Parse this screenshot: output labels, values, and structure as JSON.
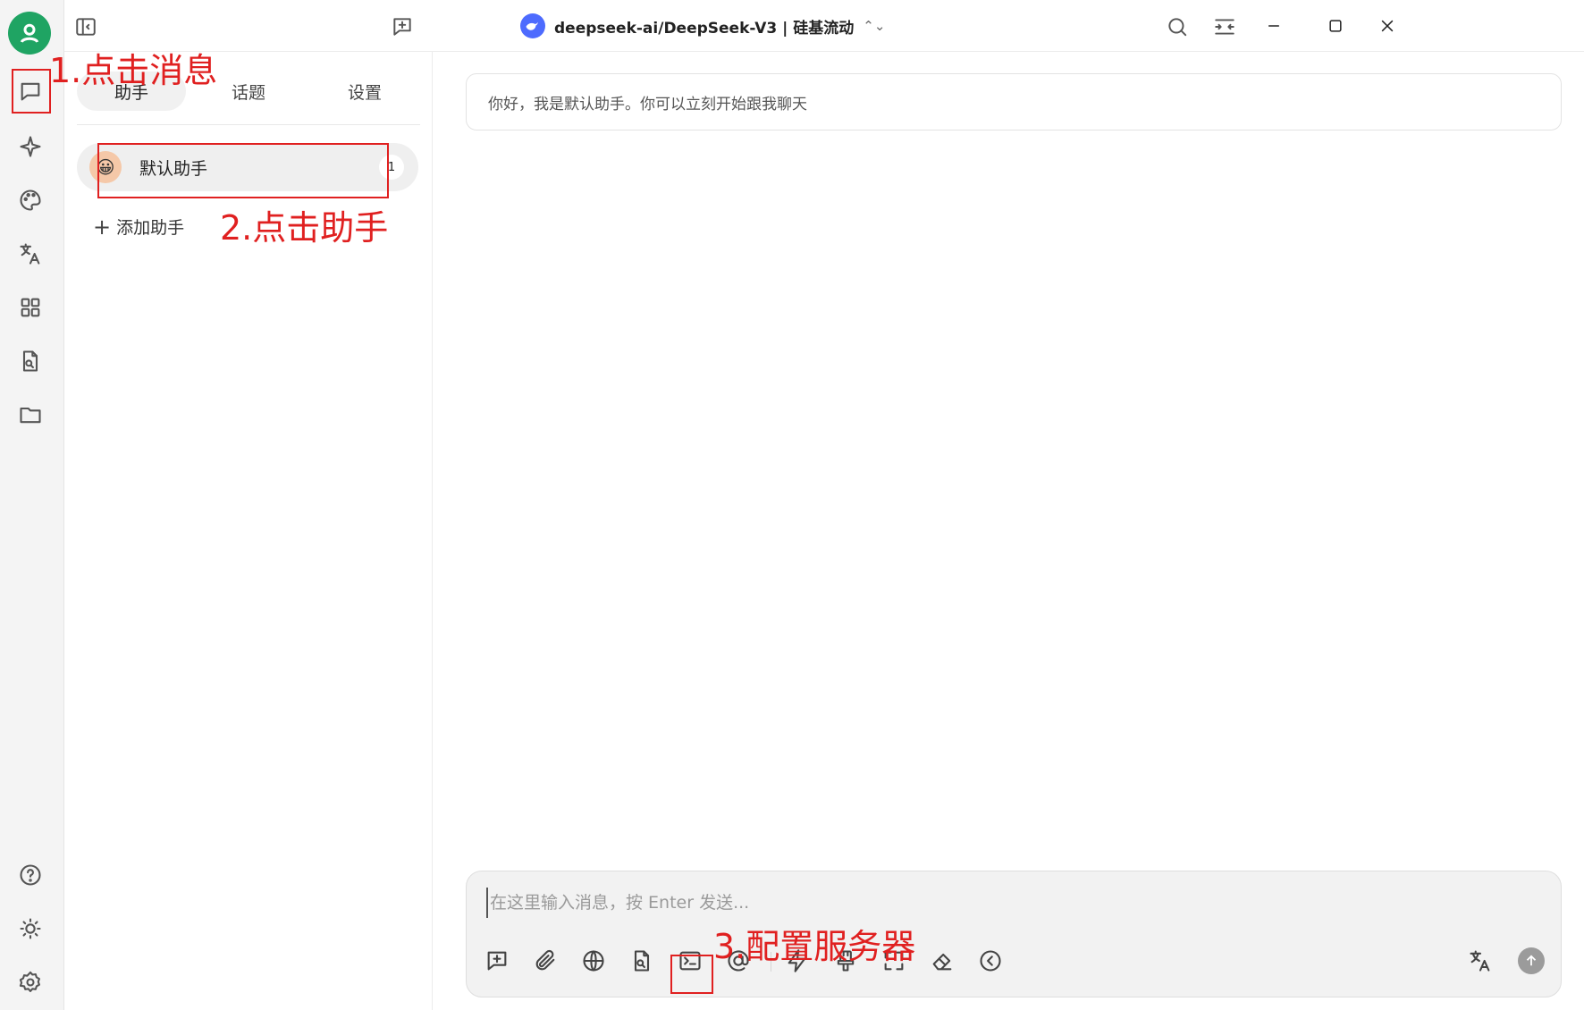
{
  "topbar": {
    "model_label": "deepseek-ai/DeepSeek-V3 | 硅基流动",
    "model_chevron": "⌃⌄",
    "icons": [
      "sidebar-toggle-icon",
      "new-topic-icon",
      "search-icon",
      "layout-icon",
      "minimize-icon",
      "maximize-icon",
      "close-icon"
    ]
  },
  "rail": {
    "items": [
      "chat-icon",
      "sparkle-icon",
      "palette-icon",
      "translate-icon",
      "apps-icon",
      "file-search-icon",
      "folder-icon"
    ],
    "bottom": [
      "help-icon",
      "theme-icon",
      "settings-icon"
    ]
  },
  "panel": {
    "tabs": [
      {
        "label": "助手",
        "active": true
      },
      {
        "label": "话题",
        "active": false
      },
      {
        "label": "设置",
        "active": false
      }
    ],
    "assistant": {
      "name": "默认助手",
      "count": "1",
      "avatar": "😀"
    },
    "add_assistant": "添加助手"
  },
  "chat": {
    "greeting": "你好，我是默认助手。你可以立刻开始跟我聊天",
    "input_placeholder": "在这里输入消息，按 Enter 发送...",
    "tools": [
      "new-topic-icon",
      "attachment-icon",
      "web-search-icon",
      "knowledge-icon",
      "mcp-terminal-icon",
      "mention-icon",
      "quick-phrase-icon",
      "clean-icon",
      "expand-icon",
      "eraser-icon",
      "collapse-icon",
      "translate-icon",
      "send-icon"
    ]
  },
  "annotations": {
    "step1": "1.点击消息",
    "step2": "2.点击助手",
    "step3": "3.配置服务器",
    "color": "#e02020"
  }
}
